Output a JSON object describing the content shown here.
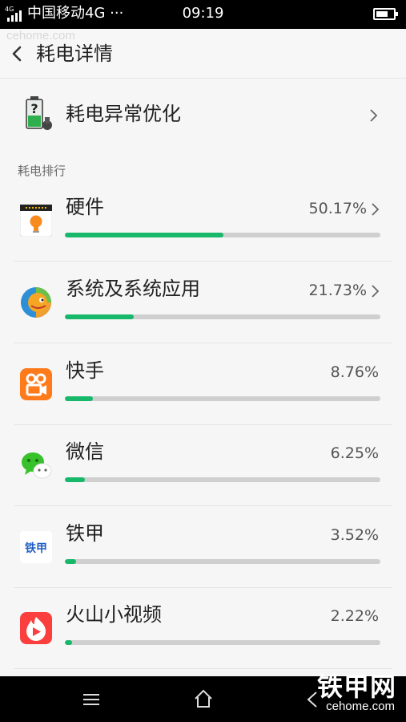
{
  "status_bar": {
    "carrier": "中国移动4G ···",
    "time": "09:19",
    "network": "4G"
  },
  "watermark": {
    "top_url": "cehome.com",
    "logo": "铁甲网",
    "url": "cehome.com"
  },
  "header": {
    "title": "耗电详情"
  },
  "optimize": {
    "label": "耗电异常优化"
  },
  "section_title": "耗电排行",
  "apps": [
    {
      "name": "硬件",
      "percent": "50.17%",
      "fraction": 0.5017,
      "has_arrow": true,
      "icon": "hardware-bulb-icon"
    },
    {
      "name": "系统及系统应用",
      "percent": "21.73%",
      "fraction": 0.2173,
      "has_arrow": true,
      "icon": "system-apps-icon"
    },
    {
      "name": "快手",
      "percent": "8.76%",
      "fraction": 0.0876,
      "has_arrow": false,
      "icon": "kuaishou-icon"
    },
    {
      "name": "微信",
      "percent": "6.25%",
      "fraction": 0.0625,
      "has_arrow": false,
      "icon": "wechat-icon"
    },
    {
      "name": "铁甲",
      "percent": "3.52%",
      "fraction": 0.0352,
      "has_arrow": false,
      "icon": "tiejia-icon",
      "icon_text": "铁甲"
    },
    {
      "name": "火山小视频",
      "percent": "2.22%",
      "fraction": 0.0222,
      "has_arrow": false,
      "icon": "huoshan-video-icon"
    }
  ],
  "colors": {
    "accent": "#17b86a",
    "track": "#cfcfcf",
    "background": "#f6f6f6"
  }
}
